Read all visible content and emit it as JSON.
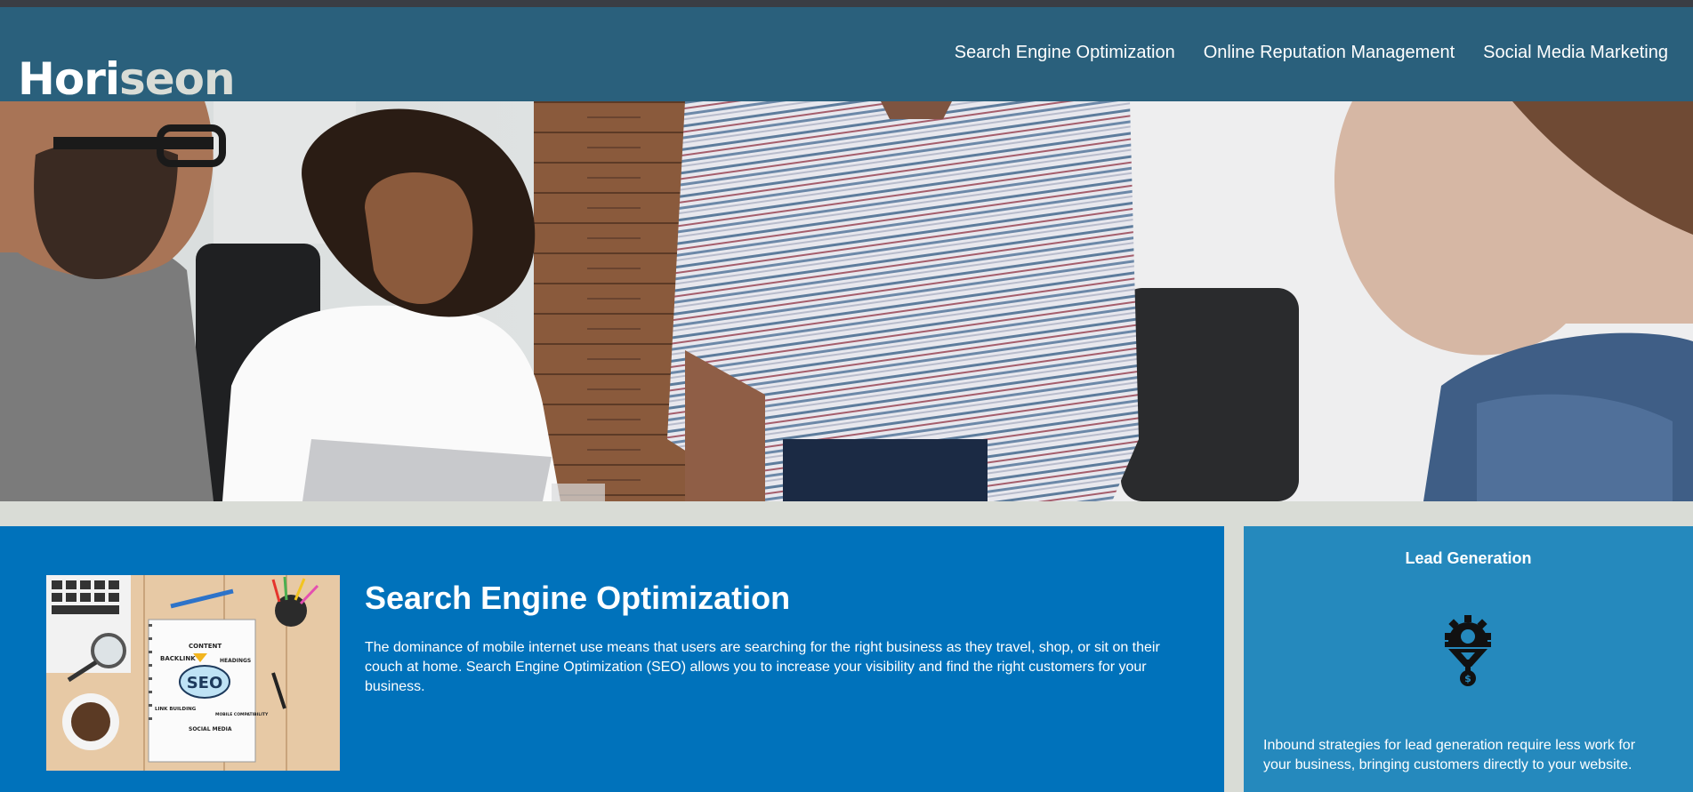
{
  "header": {
    "logo_part1": "Hori",
    "logo_part2": "seon",
    "nav": [
      {
        "label": "Search Engine Optimization"
      },
      {
        "label": "Online Reputation Management"
      },
      {
        "label": "Social Media Marketing"
      }
    ]
  },
  "seo": {
    "title": "Search Engine Optimization",
    "body": "The dominance of mobile internet use means that users are searching for the right business as they travel, shop, or sit on their couch at home. Search Engine Optimization (SEO) allows you to increase your visibility and find the right customers for your business.",
    "image_words": [
      "CONTENT",
      "BACKLINK",
      "HEADINGS",
      "SEO",
      "LINK BUILDING",
      "MOBILE COMPATIBILITY",
      "SOCIAL MEDIA"
    ]
  },
  "benefit": {
    "title": "Lead Generation",
    "body": "Inbound strategies for lead generation require less work for your business, bringing customers directly to your website."
  },
  "colors": {
    "header": "#2a607c",
    "content": "#0072bb",
    "benefit": "#2589bd",
    "page": "#d9dcd6"
  },
  "icons": [
    "hero-photo",
    "seo-notebook-image",
    "lead-generation-icon"
  ]
}
